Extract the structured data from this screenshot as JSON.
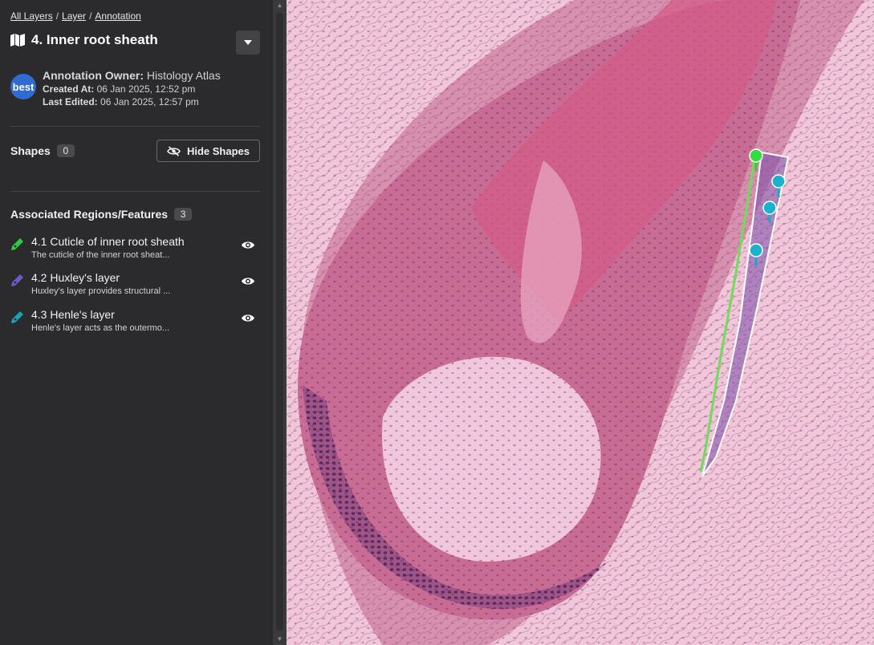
{
  "breadcrumb": {
    "all_layers": "All Layers",
    "layer": "Layer",
    "annotation": "Annotation",
    "separator": "/"
  },
  "header": {
    "title": "4. Inner root sheath"
  },
  "owner": {
    "avatar_text": "best",
    "owner_label": "Annotation Owner:",
    "owner_name": "Histology Atlas",
    "created_label": "Created At:",
    "created_value": "06 Jan 2025, 12:52 pm",
    "edited_label": "Last Edited:",
    "edited_value": "06 Jan 2025, 12:57 pm"
  },
  "shapes": {
    "label": "Shapes",
    "count": "0",
    "hide_button": "Hide Shapes"
  },
  "regions": {
    "label": "Associated Regions/Features",
    "count": "3",
    "items": [
      {
        "title": "4.1 Cuticle of inner root sheath",
        "desc": "The cuticle of the inner root sheat...",
        "color": "#2ecc40"
      },
      {
        "title": "4.2 Huxley's layer",
        "desc": "Huxley's layer provides structural ...",
        "color": "#6a5acd"
      },
      {
        "title": "4.3 Henle's layer",
        "desc": "Henle's layer acts as the outermo...",
        "color": "#17a2b8"
      }
    ]
  },
  "colors": {
    "sidebar_bg": "#2b2b2d",
    "accent_green": "#2ecc40",
    "accent_purple": "#6a5acd",
    "accent_teal": "#17a2b8"
  }
}
